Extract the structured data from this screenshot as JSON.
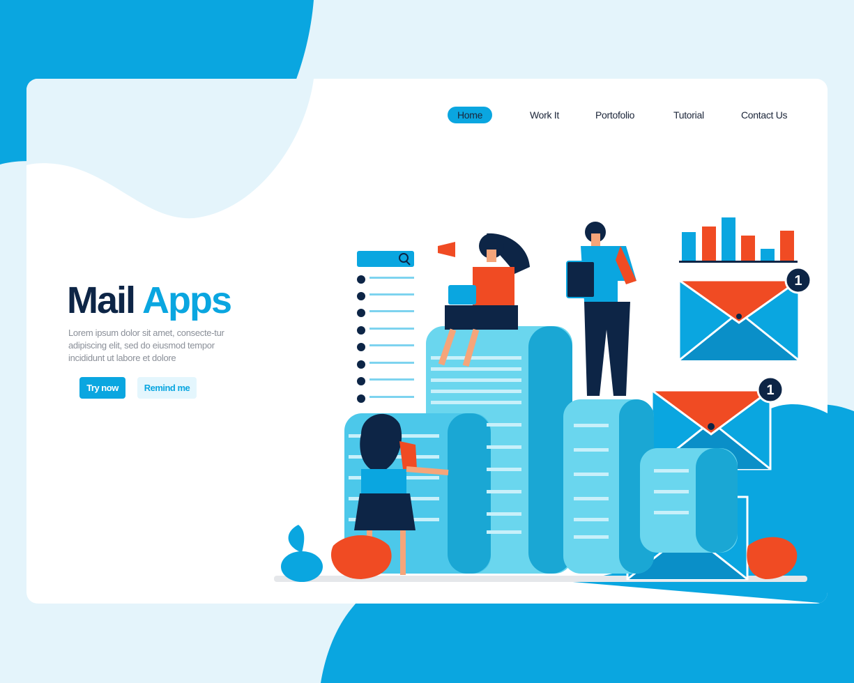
{
  "nav": {
    "items": [
      {
        "label": "Home",
        "active": true
      },
      {
        "label": "Work It",
        "active": false
      },
      {
        "label": "Portofolio",
        "active": false
      },
      {
        "label": "Tutorial",
        "active": false
      },
      {
        "label": "Contact Us",
        "active": false
      }
    ]
  },
  "hero": {
    "title_part1": "Mail",
    "title_part2": "Apps",
    "description": "Lorem ipsum dolor sit amet, consecte-tur adipiscing elit, sed do eiusmod tempor incididunt ut labore et dolore",
    "primary_button": "Try now",
    "secondary_button": "Remind me"
  },
  "illustration": {
    "notification_badge_1": "1",
    "notification_badge_2": "1"
  },
  "colors": {
    "accent": "#0aa6e0",
    "dark": "#0d2546",
    "orange": "#f04b23",
    "background": "#e4f4fb"
  }
}
